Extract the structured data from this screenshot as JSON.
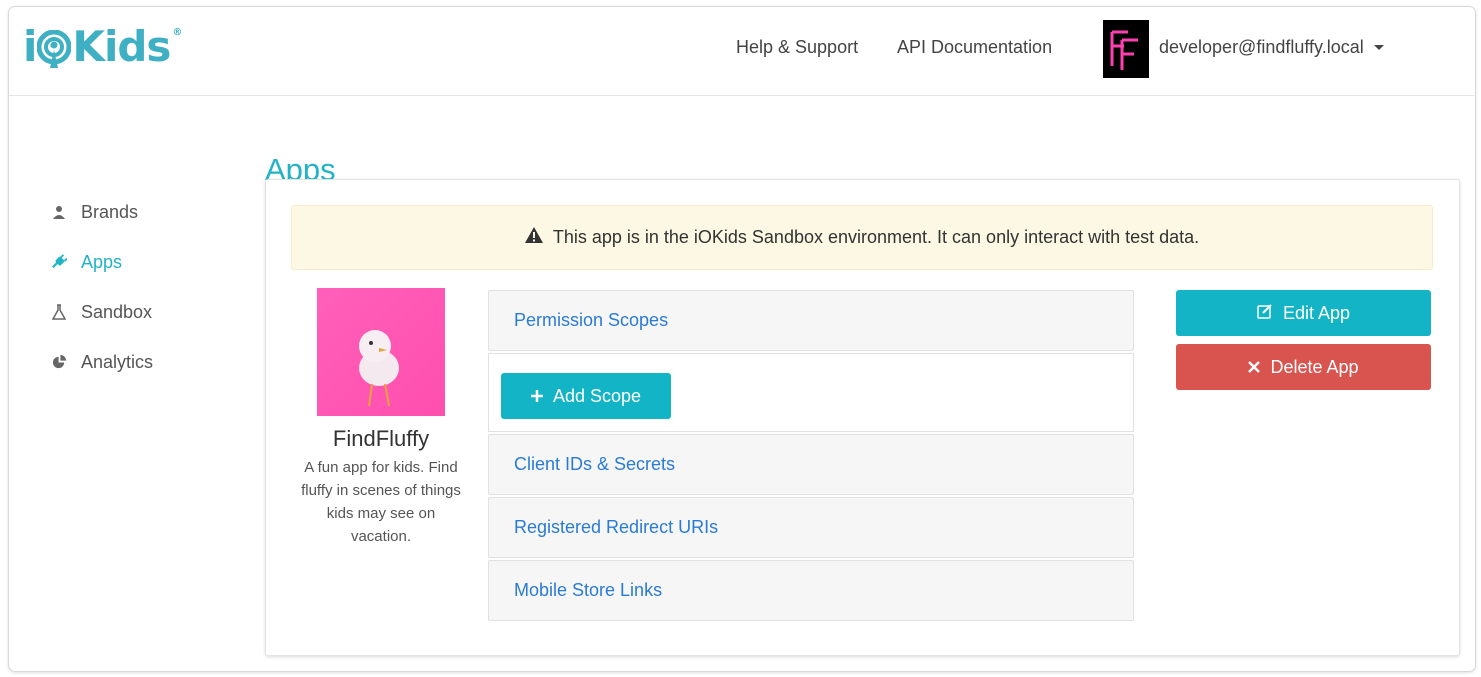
{
  "header": {
    "logo_text": "iOKids",
    "links": [
      "Help & Support",
      "API Documentation"
    ],
    "avatar_text": "FF",
    "user_email": "developer@findfluffy.local"
  },
  "sidebar": {
    "items": [
      {
        "label": "Brands",
        "icon": "user-icon",
        "active": false
      },
      {
        "label": "Apps",
        "icon": "plug-icon",
        "active": true
      },
      {
        "label": "Sandbox",
        "icon": "flask-icon",
        "active": false
      },
      {
        "label": "Analytics",
        "icon": "pie-chart-icon",
        "active": false
      }
    ]
  },
  "main": {
    "title": "Apps",
    "alert_text": "This app is in the iOKids Sandbox environment. It can only interact with test data.",
    "app": {
      "name": "FindFluffy",
      "description": "A fun app for kids. Find fluffy in scenes of things kids may see on vacation."
    },
    "sections": {
      "permission_scopes": "Permission Scopes",
      "add_scope": "Add Scope",
      "client_ids": "Client IDs & Secrets",
      "redirect_uris": "Registered Redirect URIs",
      "store_links": "Mobile Store Links"
    },
    "actions": {
      "edit": "Edit App",
      "delete": "Delete App"
    }
  },
  "colors": {
    "accent": "#22b3c6",
    "link": "#2a7bd2",
    "danger": "#d9534f",
    "alert_bg": "#fcf8e3"
  }
}
